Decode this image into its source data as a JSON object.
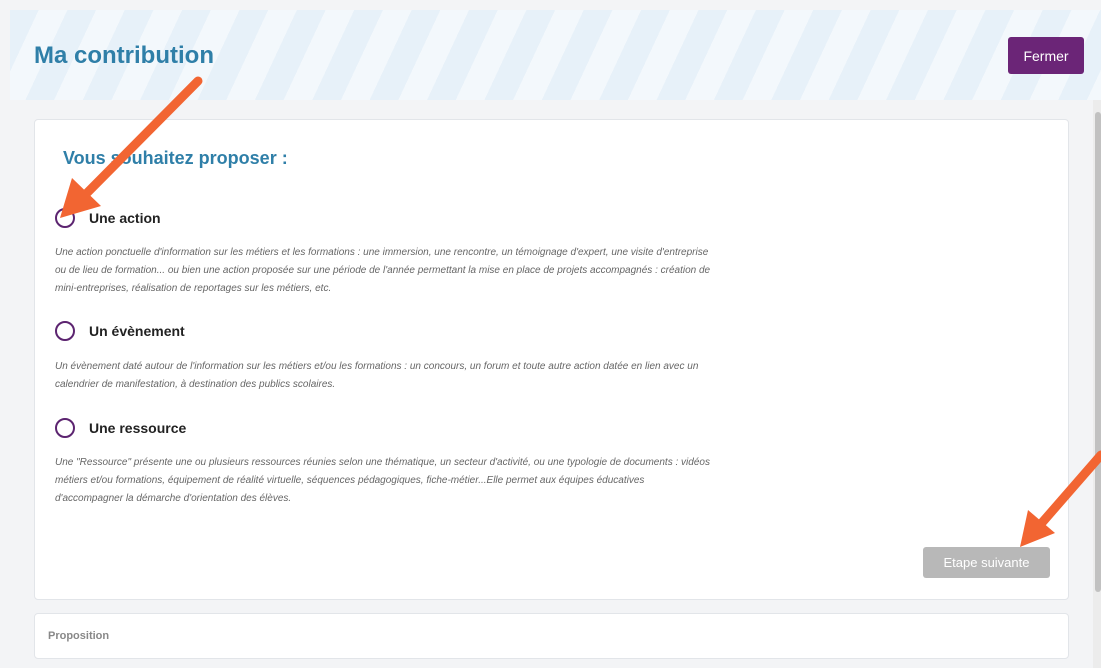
{
  "modal": {
    "title": "Ma contribution",
    "close_label": "Fermer"
  },
  "form": {
    "heading": "Vous souhaitez proposer :",
    "options": [
      {
        "label": "Une action",
        "description": "Une action ponctuelle d'information sur les métiers et les formations : une immersion, une rencontre, un témoignage d'expert, une visite d'entreprise ou de lieu de formation... ou bien une action proposée sur une période de l'année permettant la mise en place de projets accompagnés : création de mini-entreprises, réalisation de reportages sur les métiers, etc."
      },
      {
        "label": "Un évènement",
        "description": "Un évènement daté autour de l'information sur les métiers et/ou les formations : un concours, un forum et toute autre action datée en lien avec un calendrier de manifestation, à destination des publics scolaires."
      },
      {
        "label": "Une ressource",
        "description": "Une \"Ressource\" présente une ou plusieurs ressources réunies selon une thématique, un secteur d'activité, ou une typologie de documents : vidéos métiers et/ou formations, équipement de réalité virtuelle, séquences pédagogiques, fiche-métier...Elle permet aux équipes éducatives d'accompagner la démarche d'orientation des élèves."
      }
    ],
    "next_label": "Etape suivante",
    "section_proposition": "Proposition"
  },
  "colors": {
    "title_blue": "#2f7fa8",
    "purple": "#6b2577",
    "annotation_arrow": "#f26532",
    "disabled_button": "#b8b8b8"
  }
}
